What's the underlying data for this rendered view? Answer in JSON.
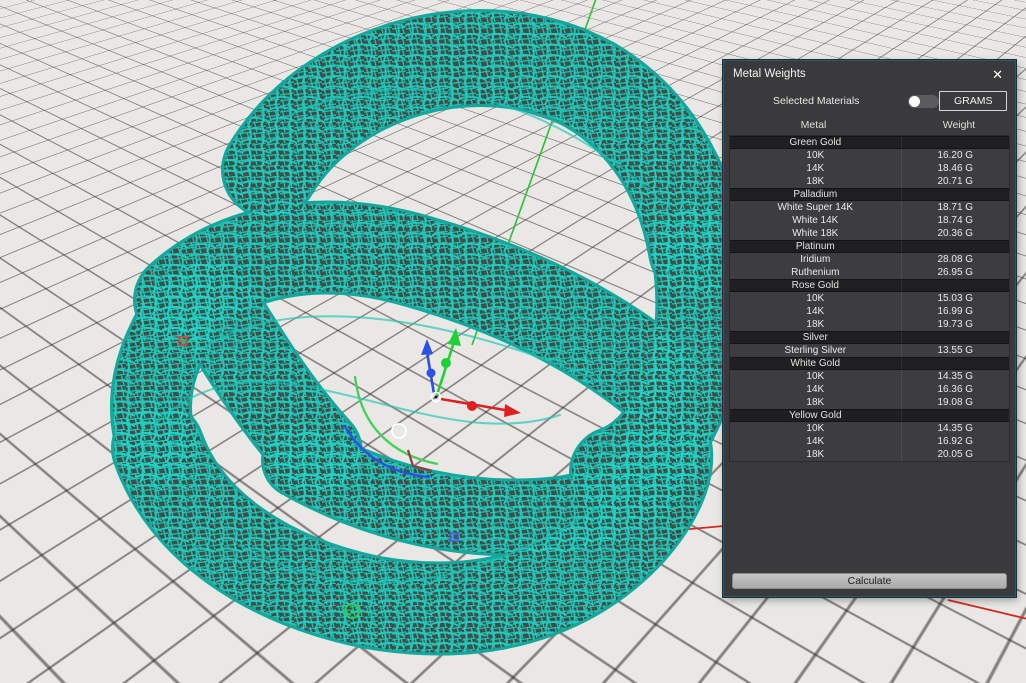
{
  "panel": {
    "title": "Metal Weights",
    "close_icon": "✕",
    "selected_materials_label": "Selected Materials",
    "units_button": "GRAMS",
    "toggle_state": "off",
    "columns": {
      "metal": "Metal",
      "weight": "Weight"
    },
    "groups": [
      {
        "name": "Green Gold",
        "rows": [
          {
            "metal": "10K",
            "weight": "16.20 G"
          },
          {
            "metal": "14K",
            "weight": "18.46 G"
          },
          {
            "metal": "18K",
            "weight": "20.71 G"
          }
        ]
      },
      {
        "name": "Palladium",
        "rows": [
          {
            "metal": "White Super 14K",
            "weight": "18.71 G"
          },
          {
            "metal": "White 14K",
            "weight": "18.74 G"
          },
          {
            "metal": "White 18K",
            "weight": "20.36 G"
          }
        ]
      },
      {
        "name": "Platinum",
        "rows": [
          {
            "metal": "Iridium",
            "weight": "28.08 G"
          },
          {
            "metal": "Ruthenium",
            "weight": "26.95 G"
          }
        ]
      },
      {
        "name": "Rose Gold",
        "rows": [
          {
            "metal": "10K",
            "weight": "15.03 G"
          },
          {
            "metal": "14K",
            "weight": "16.99 G"
          },
          {
            "metal": "18K",
            "weight": "19.73 G"
          }
        ]
      },
      {
        "name": "Silver",
        "rows": [
          {
            "metal": "Sterling Silver",
            "weight": "13.55 G"
          }
        ]
      },
      {
        "name": "White Gold",
        "rows": [
          {
            "metal": "10K",
            "weight": "14.35 G"
          },
          {
            "metal": "14K",
            "weight": "16.36 G"
          },
          {
            "metal": "18K",
            "weight": "19.08 G"
          }
        ]
      },
      {
        "name": "Yellow Gold",
        "rows": [
          {
            "metal": "10K",
            "weight": "14.35 G"
          },
          {
            "metal": "14K",
            "weight": "16.92 G"
          },
          {
            "metal": "18K",
            "weight": "20.05 G"
          }
        ]
      }
    ],
    "calculate_button": "Calculate",
    "colors": {
      "panel_bg": "#3a3a3d",
      "category_row_bg": "#1f1f22",
      "panel_border": "#2a5a6e",
      "calculate_bg": "#b8b8b8"
    }
  },
  "viewport": {
    "background": "#e9e8e5",
    "model_wireframe_color": "#1fb5ab",
    "axis_colors": {
      "x_red": "#d42a22",
      "y_green": "#2bbf3a",
      "z_blue": "#2b50e8"
    }
  }
}
